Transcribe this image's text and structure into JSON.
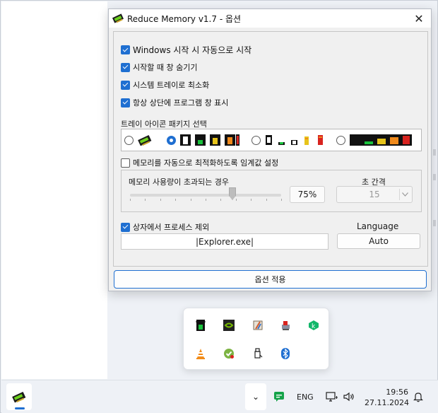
{
  "window": {
    "title": "Reduce Memory v1.7 - 옵션",
    "close_glyph": "✕"
  },
  "options": {
    "startup": "Windows 시작 시 자동으로 시작",
    "hide_on_start": "시작할 때 창 숨기기",
    "minimize_to_tray": "시스템 트레이로 최소화",
    "always_on_top": "항상 상단에 프로그램 창 표시"
  },
  "icon_pack": {
    "label": "트레이 아이콘 패키지 선택",
    "selected_index": 1
  },
  "auto_optimize": {
    "label": "메모리를 자동으로 최적화하도록 임계값 설정",
    "usage_label": "메모리 사용량이 초과되는 경우",
    "percent": "75%",
    "slider_value": 0.75,
    "interval_label": "초 간격",
    "interval_value": "15"
  },
  "exclude": {
    "label": "상자에서 프로세스 제외",
    "process_value": "|Explorer.exe|"
  },
  "language": {
    "label": "Language",
    "value": "Auto"
  },
  "apply_button": "옵션 적용",
  "taskbar": {
    "chevron": "⌄",
    "input_language": "ENG",
    "time": "19:56",
    "date": "27.11.2024"
  },
  "tray_icons": [
    "reduce-memory-icon",
    "nvidia-icon",
    "pencil-tool-icon",
    "app-stamp-icon",
    "kaspersky-icon",
    "vlc-icon",
    "security-check-icon",
    "usb-drive-icon",
    "bluetooth-icon"
  ],
  "colors": {
    "accent": "#1f6fd1",
    "chip_green": "#19c23c",
    "chip_yellow": "#e7c41b",
    "chip_orange": "#f08a1c",
    "chip_red": "#d8231f"
  }
}
